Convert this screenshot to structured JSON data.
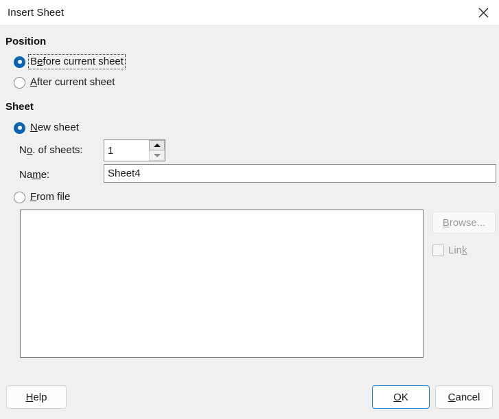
{
  "window": {
    "title": "Insert Sheet",
    "close_icon": "close-icon"
  },
  "position_group": {
    "title": "Position",
    "options": [
      {
        "label_before": "B",
        "label_accel": "e",
        "label_after": "fore current sheet",
        "full_label": "Before current sheet",
        "selected": true,
        "focused": true
      },
      {
        "label_before": "",
        "label_accel": "A",
        "label_after": "fter current sheet",
        "full_label": "After current sheet",
        "selected": false,
        "focused": false
      }
    ]
  },
  "sheet_group": {
    "title": "Sheet",
    "new_sheet": {
      "label_before": "",
      "label_accel": "N",
      "label_after": "ew sheet",
      "full_label": "New sheet",
      "selected": true
    },
    "no_of_sheets": {
      "label_before": "N",
      "label_accel": "o",
      "label_after": ". of sheets:",
      "full_label": "No. of sheets:",
      "value": "1",
      "spin_up_icon": "triangle-up-icon",
      "spin_down_icon": "triangle-down-icon"
    },
    "name": {
      "label_before": "Na",
      "label_accel": "m",
      "label_after": "e:",
      "full_label": "Name:",
      "value": "Sheet4",
      "placeholder": ""
    },
    "from_file": {
      "label_before": "",
      "label_accel": "F",
      "label_after": "rom file",
      "full_label": "From file",
      "selected": false
    },
    "file_list": {
      "items": []
    },
    "browse": {
      "label_before": "",
      "label_accel": "B",
      "label_after": "rowse...",
      "full_label": "Browse...",
      "enabled": false
    },
    "link": {
      "label_before": "Lin",
      "label_accel": "k",
      "label_after": "",
      "full_label": "Link",
      "checked": false,
      "enabled": false
    }
  },
  "footer": {
    "help": {
      "label_before": "",
      "label_accel": "H",
      "label_after": "elp",
      "full_label": "Help"
    },
    "ok": {
      "label_before": "",
      "label_accel": "O",
      "label_after": "K",
      "full_label": "OK",
      "is_default": true
    },
    "cancel": {
      "label_before": "",
      "label_accel": "C",
      "label_after": "ancel",
      "full_label": "Cancel"
    }
  },
  "colors": {
    "accent": "#0a64b4",
    "default_button_border": "#1878c8",
    "body_background": "#f0f0f0",
    "titlebar_background": "#ffffff",
    "disabled_text": "#9a9a9a"
  }
}
